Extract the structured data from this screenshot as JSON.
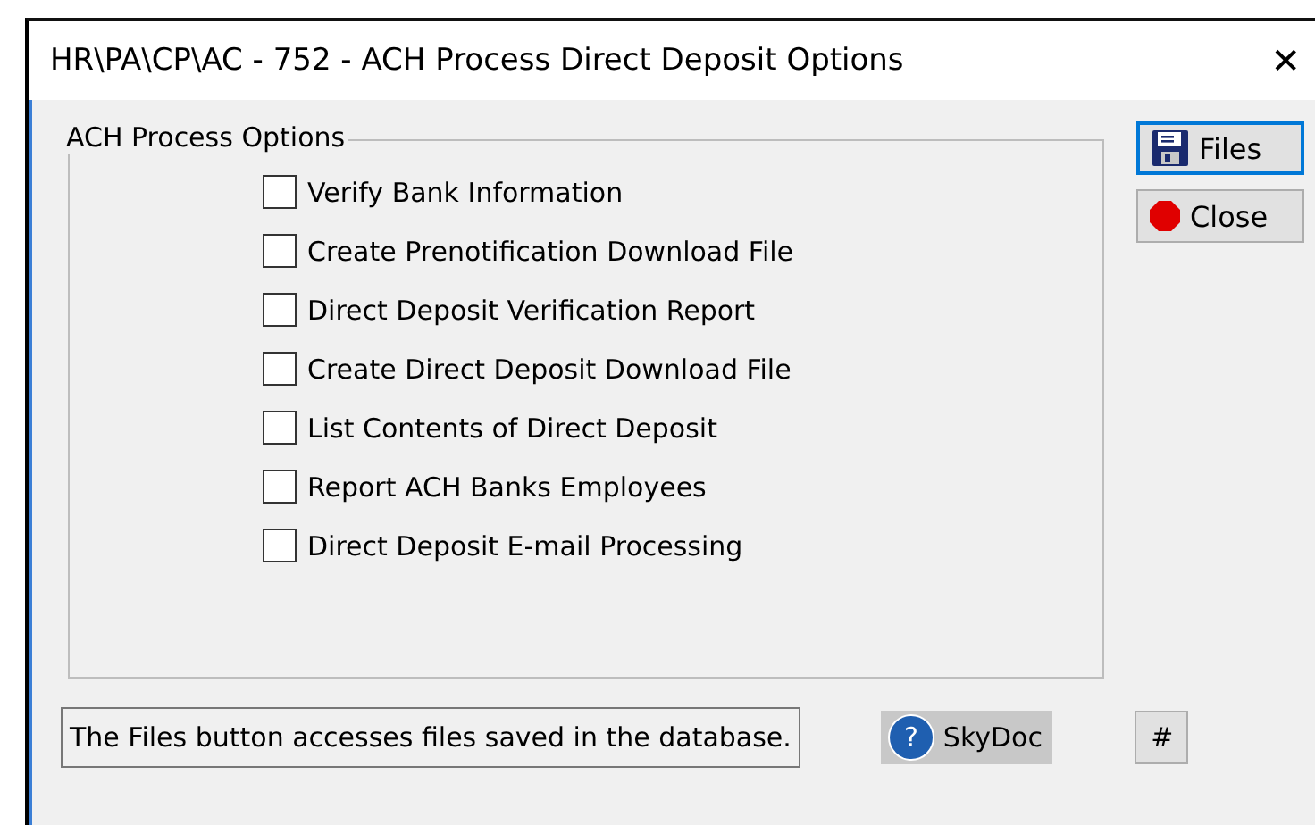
{
  "window": {
    "title": "HR\\PA\\CP\\AC - 752 - ACH Process Direct Deposit Options",
    "close": "✕"
  },
  "group": {
    "title": "ACH Process Options",
    "options": [
      {
        "label": "Verify Bank Information",
        "checked": false
      },
      {
        "label": "Create Prenotification Download File",
        "checked": false
      },
      {
        "label": "Direct Deposit Verification Report",
        "checked": false
      },
      {
        "label": "Create Direct Deposit Download File",
        "checked": false
      },
      {
        "label": "List Contents of Direct Deposit",
        "checked": false
      },
      {
        "label": "Report ACH Banks Employees",
        "checked": false
      },
      {
        "label": "Direct Deposit E-mail Processing",
        "checked": false
      }
    ]
  },
  "buttons": [
    {
      "label": "Files",
      "kind": "files",
      "selected": true
    },
    {
      "label": "Close",
      "kind": "close",
      "selected": false
    }
  ],
  "status": "The Files button accesses files saved in the database.",
  "skydoc": {
    "icon": "?",
    "label": "SkyDoc"
  },
  "hash": "#"
}
